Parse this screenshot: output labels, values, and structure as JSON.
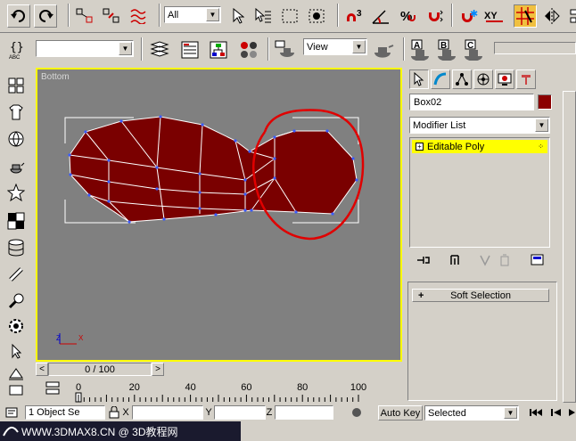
{
  "toolbar_top": {
    "selection_filter": "All",
    "icons": [
      "undo-icon",
      "redo-icon",
      "select-and-link-icon",
      "unlink-icon",
      "bind-spacewarp-icon",
      "select-object-icon",
      "select-by-name-icon",
      "rect-selection-icon",
      "window-crossing-icon",
      "angle-snap-icon",
      "percent-snap-icon",
      "spinner-snap-icon",
      "edit-named-selections-icon",
      "mirror-icon",
      "align-icon",
      "named-selection-xy-icon",
      "snap-toggle-icon"
    ],
    "snap_label": "3",
    "xy_label": "XY"
  },
  "toolbar_second": {
    "named_selection_value": "",
    "reference_coord": "View",
    "abc_label": "ABC"
  },
  "render_buttons": [
    "A",
    "B",
    "C"
  ],
  "viewport": {
    "label": "Bottom",
    "axis_x": "X",
    "axis_z": "Z"
  },
  "command_panel": {
    "object_name": "Box02",
    "object_color": "#8b0000",
    "modifier_list_label": "Modifier List",
    "stack_items": [
      {
        "label": "Editable Poly"
      }
    ],
    "rollout_title": "Soft Selection"
  },
  "time_slider": {
    "frame_label": "0 / 100",
    "prev": "<",
    "next": ">"
  },
  "track_ruler": {
    "ticks": [
      "0",
      "20",
      "40",
      "60",
      "80",
      "100"
    ]
  },
  "status_bar": {
    "selection_count": "1 Object Se",
    "x_label": "X",
    "y_label": "Y",
    "z_label": "Z",
    "auto_key_label": "Auto Key",
    "key_filter_value": "Selected"
  },
  "watermark": {
    "site_text": "WWW.3DMAX8.CN @ 3D教程网"
  },
  "colors": {
    "viewport_bg": "#808080",
    "active_border": "#ffff00",
    "mesh_fill": "#7a0000",
    "annotation_circle": "#e00000"
  }
}
